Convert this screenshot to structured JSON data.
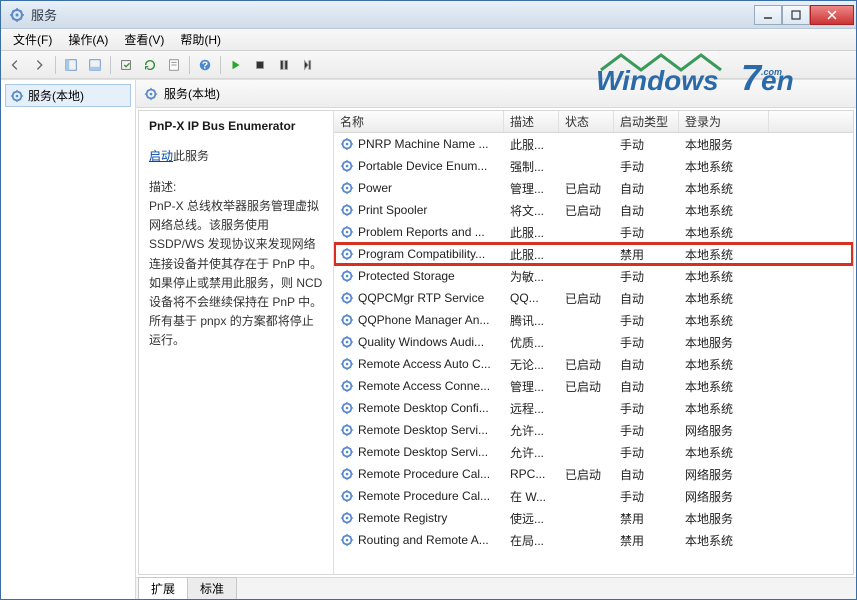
{
  "window": {
    "title": "服务"
  },
  "menu": {
    "file": "文件(F)",
    "action": "操作(A)",
    "view": "查看(V)",
    "help": "帮助(H)"
  },
  "tree": {
    "local": "服务(本地)"
  },
  "right_header": "服务(本地)",
  "detail": {
    "title": "PnP-X IP Bus Enumerator",
    "start_link": "启动",
    "start_suffix": "此服务",
    "desc_label": "描述:",
    "desc": "PnP-X 总线枚举器服务管理虚拟网络总线。该服务使用 SSDP/WS 发现协议来发现网络连接设备并使其存在于 PnP 中。如果停止或禁用此服务，则 NCD 设备将不会继续保持在 PnP 中。所有基于 pnpx 的方案都将停止运行。"
  },
  "columns": {
    "name": "名称",
    "desc": "描述",
    "status": "状态",
    "startup": "启动类型",
    "logon": "登录为"
  },
  "tabs": {
    "extended": "扩展",
    "standard": "标准"
  },
  "services": [
    {
      "name": "PNRP Machine Name ...",
      "desc": "此服...",
      "status": "",
      "startup": "手动",
      "logon": "本地服务",
      "hl": false
    },
    {
      "name": "Portable Device Enum...",
      "desc": "强制...",
      "status": "",
      "startup": "手动",
      "logon": "本地系统",
      "hl": false
    },
    {
      "name": "Power",
      "desc": "管理...",
      "status": "已启动",
      "startup": "自动",
      "logon": "本地系统",
      "hl": false
    },
    {
      "name": "Print Spooler",
      "desc": "将文...",
      "status": "已启动",
      "startup": "自动",
      "logon": "本地系统",
      "hl": false
    },
    {
      "name": "Problem Reports and ...",
      "desc": "此服...",
      "status": "",
      "startup": "手动",
      "logon": "本地系统",
      "hl": false
    },
    {
      "name": "Program Compatibility...",
      "desc": "此服...",
      "status": "",
      "startup": "禁用",
      "logon": "本地系统",
      "hl": true
    },
    {
      "name": "Protected Storage",
      "desc": "为敏...",
      "status": "",
      "startup": "手动",
      "logon": "本地系统",
      "hl": false
    },
    {
      "name": "QQPCMgr RTP Service",
      "desc": "QQ...",
      "status": "已启动",
      "startup": "自动",
      "logon": "本地系统",
      "hl": false
    },
    {
      "name": "QQPhone Manager An...",
      "desc": "腾讯...",
      "status": "",
      "startup": "手动",
      "logon": "本地系统",
      "hl": false
    },
    {
      "name": "Quality Windows Audi...",
      "desc": "优质...",
      "status": "",
      "startup": "手动",
      "logon": "本地服务",
      "hl": false
    },
    {
      "name": "Remote Access Auto C...",
      "desc": "无论...",
      "status": "已启动",
      "startup": "自动",
      "logon": "本地系统",
      "hl": false
    },
    {
      "name": "Remote Access Conne...",
      "desc": "管理...",
      "status": "已启动",
      "startup": "自动",
      "logon": "本地系统",
      "hl": false
    },
    {
      "name": "Remote Desktop Confi...",
      "desc": "远程...",
      "status": "",
      "startup": "手动",
      "logon": "本地系统",
      "hl": false
    },
    {
      "name": "Remote Desktop Servi...",
      "desc": "允许...",
      "status": "",
      "startup": "手动",
      "logon": "网络服务",
      "hl": false
    },
    {
      "name": "Remote Desktop Servi...",
      "desc": "允许...",
      "status": "",
      "startup": "手动",
      "logon": "本地系统",
      "hl": false
    },
    {
      "name": "Remote Procedure Cal...",
      "desc": "RPC...",
      "status": "已启动",
      "startup": "自动",
      "logon": "网络服务",
      "hl": false
    },
    {
      "name": "Remote Procedure Cal...",
      "desc": "在 W...",
      "status": "",
      "startup": "手动",
      "logon": "网络服务",
      "hl": false
    },
    {
      "name": "Remote Registry",
      "desc": "使远...",
      "status": "",
      "startup": "禁用",
      "logon": "本地服务",
      "hl": false
    },
    {
      "name": "Routing and Remote A...",
      "desc": "在局...",
      "status": "",
      "startup": "禁用",
      "logon": "本地系统",
      "hl": false
    }
  ]
}
